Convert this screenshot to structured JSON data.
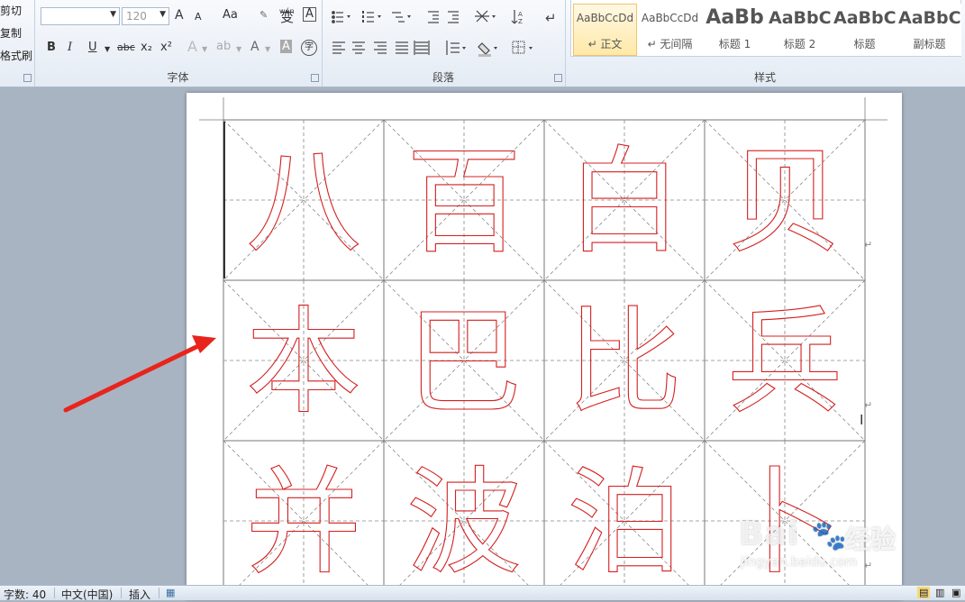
{
  "clipboard": {
    "cut_label": "剪切",
    "copy_label": "复制",
    "format_painter_label": "格式刷"
  },
  "font": {
    "group_label": "字体",
    "font_name_value": "",
    "font_size_value": "120",
    "grow_label": "A",
    "shrink_label": "A",
    "change_case_label": "Aa",
    "bold_label": "B",
    "italic_label": "I",
    "underline_label": "U",
    "strike_label": "abc",
    "subscript_label": "x₂",
    "superscript_label": "x²",
    "font_color_label": "A",
    "char_shading_label": "A",
    "enclose_label": "字",
    "phonetic_label": "wén",
    "phonetic_char": "变",
    "char_border_label": "A",
    "text_effect_label": "A"
  },
  "paragraph": {
    "group_label": "段落"
  },
  "styles": {
    "group_label": "样式",
    "items": [
      {
        "sample": "AaBbCcDd",
        "name": "↵ 正文",
        "active": true
      },
      {
        "sample": "AaBbCcDd",
        "name": "↵ 无间隔",
        "active": false
      },
      {
        "sample": "AaBb",
        "name": "标题 1",
        "active": false
      },
      {
        "sample": "AaBbC",
        "name": "标题 2",
        "active": false
      },
      {
        "sample": "AaBbC",
        "name": "标题",
        "active": false
      },
      {
        "sample": "AaBbC",
        "name": "副标题",
        "active": false
      }
    ]
  },
  "document": {
    "characters": [
      "八",
      "百",
      "白",
      "贝",
      "本",
      "巴",
      "比",
      "兵",
      "并",
      "波",
      "泊",
      "卜"
    ],
    "accent_color": "#d42020",
    "grid_color": "#888888",
    "arrow_color": "#e8241c"
  },
  "status": {
    "word_count": "字数: 40",
    "language": "中文(中国)",
    "insert_mode": "插入"
  },
  "watermark": {
    "brand": "Bai",
    "brand2": "经验",
    "url": "jingyan.baidu.com"
  }
}
